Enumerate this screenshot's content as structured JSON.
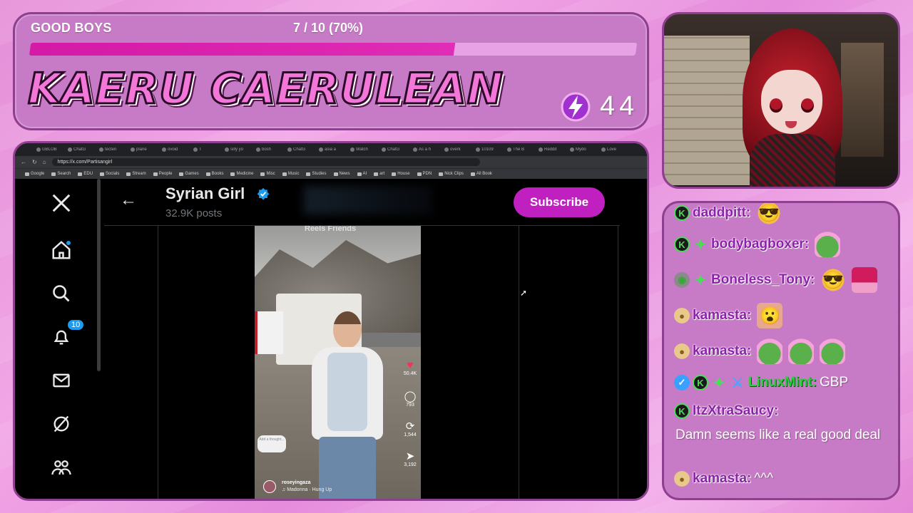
{
  "goal": {
    "label": "GOOD BOYS",
    "count": "7 / 10 (70%)",
    "fraction": 0.7
  },
  "streamer": {
    "name": "KAERU CAERULEAN",
    "bits_count": "44",
    "bits_icon": "lightning-bolt-icon"
  },
  "browser": {
    "tabs": [
      "GBLOB",
      "ChatG",
      "tecten",
      "plane",
      "ovoid",
      "T",
      "silly yo",
      "bosh",
      "ChatG",
      "asia a",
      "Watch",
      "ChatG",
      "As a h",
      "overk",
      "10109",
      "The B",
      "Reddit",
      "Mydo",
      "Love"
    ],
    "url": "https://x.com/Partisangirl",
    "bookmarks": [
      "Google",
      "Search",
      "EDU",
      "Socials",
      "Stream",
      "People",
      "Games",
      "Books",
      "Medicine",
      "Misc",
      "Music",
      "Studies",
      "News",
      "AI",
      "art",
      "House",
      "PDN",
      "Nick Clips",
      "All Book"
    ]
  },
  "x_page": {
    "profile_name": "Syrian Girl",
    "post_count": "32.9K posts",
    "subscribe_label": "Subscribe",
    "notification_count": "10",
    "nav_icons": [
      "x-logo-icon",
      "home-icon",
      "search-icon",
      "bell-icon",
      "mail-icon",
      "grok-icon",
      "communities-icon"
    ],
    "video": {
      "top_label": "Reels   Friends",
      "likes": "50.4K",
      "comments": "793",
      "reposts": "1,544",
      "shares": "3,192",
      "thought_prompt": "Add a thought...",
      "username": "roseyingaza",
      "song": "♫ Madonna · Hung Up"
    }
  },
  "chat": [
    {
      "user": "daddpitt:"
    },
    {
      "user": "bodybagboxer:"
    },
    {
      "user": "Boneless_Tony:"
    },
    {
      "user": "kamasta:"
    },
    {
      "user": "kamasta:"
    },
    {
      "user": "LinuxMint:",
      "text": "GBP"
    },
    {
      "user": "ItzXtraSaucy:",
      "text": "Damn seems like a real good deal"
    },
    {
      "user": "kamasta:",
      "text": "^^^"
    }
  ]
}
